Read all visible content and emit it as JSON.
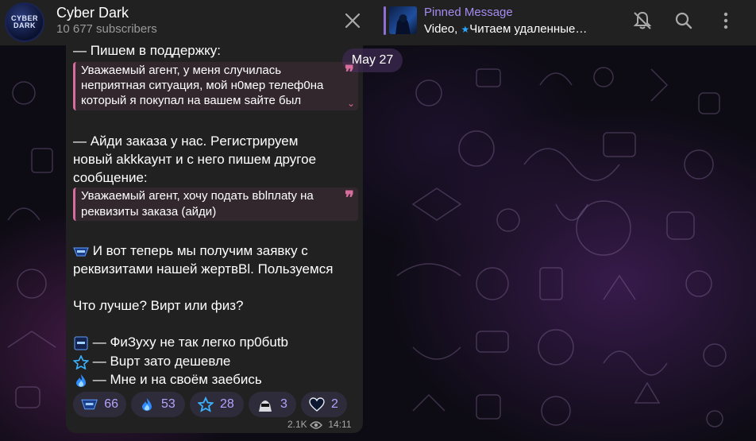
{
  "channel": {
    "name": "Cyber Dark",
    "subscribers": "10 677 subscribers",
    "avatar_line1": "CYBER",
    "avatar_line2": "DARK"
  },
  "pinned": {
    "title": "Pinned Message",
    "prefix": "Video, ",
    "text": "Читаем удаленные…"
  },
  "date_pill": "May 27",
  "message": {
    "line1": "— Пишем в поддержку:",
    "quote1": [
      "Уважаемый агент, у меня случилась",
      "неприятная ситуация, мой н0мер телеф0на",
      "который я покупал на вашем saйте был"
    ],
    "para2": [
      "— Айди заказа у нас. Peгистрируем",
      "новый akkkaунт и с него пишем другое",
      "сообщение:"
    ],
    "quote2": [
      "Уважаемый агент, хочу подать вblплаty на",
      "реквизиты заказа (айди)"
    ],
    "para3": [
      "И вот теперь мы получим заявку с",
      "реквизитами нашей жертвBl. Пользуемся"
    ],
    "question": "Что лучше? Вирт или физ?",
    "options": [
      {
        "icon": "cyber-dark-emoji-icon",
        "text": "—  ФиЗуху не так легко пр0бutb"
      },
      {
        "icon": "star-icon",
        "text": "—  Bupт зато дешевле"
      },
      {
        "icon": "flame-icon",
        "text": "—  Мне и на своём заебись"
      }
    ]
  },
  "reactions": [
    {
      "icon": "cyber-dark-emoji-icon",
      "count": "66"
    },
    {
      "icon": "flame-icon",
      "count": "53"
    },
    {
      "icon": "star-icon",
      "count": "28"
    },
    {
      "icon": "hacker-emoji-icon",
      "count": "3"
    },
    {
      "icon": "heart-icon",
      "count": "2"
    }
  ],
  "views": "2.1K",
  "time": "14:11",
  "colors": {
    "accent": "#8e6fd8",
    "quote": "#d76d9c",
    "reaction_text": "#b7a3ff",
    "bubble": "#212121",
    "header": "#212121"
  }
}
